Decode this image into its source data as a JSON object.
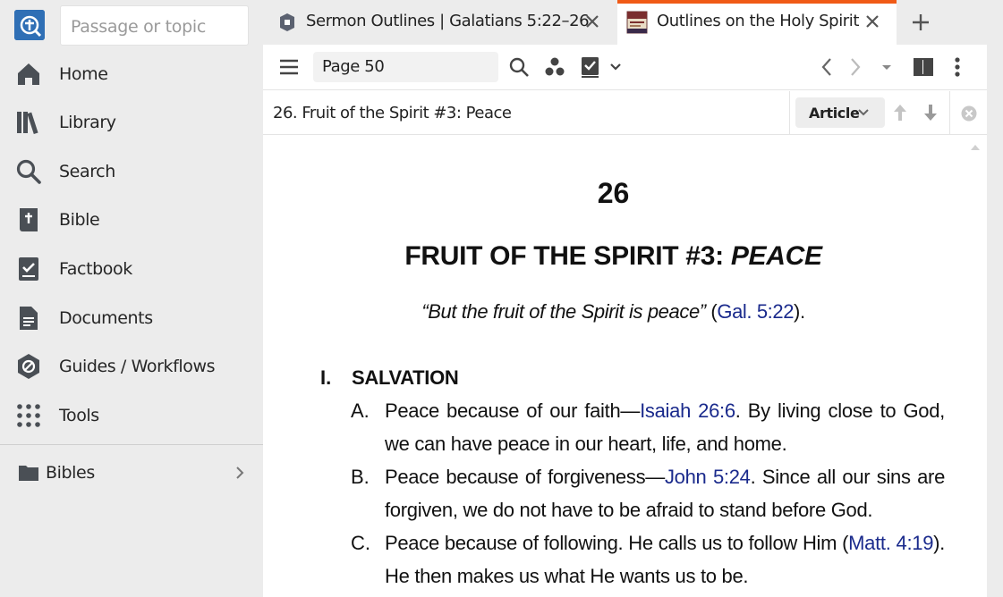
{
  "sidebar": {
    "search_placeholder": "Passage or topic",
    "items": [
      {
        "label": "Home",
        "icon": "home-icon"
      },
      {
        "label": "Library",
        "icon": "library-icon"
      },
      {
        "label": "Search",
        "icon": "search-icon"
      },
      {
        "label": "Bible",
        "icon": "bible-icon"
      },
      {
        "label": "Factbook",
        "icon": "factbook-icon"
      },
      {
        "label": "Documents",
        "icon": "documents-icon"
      },
      {
        "label": "Guides / Workflows",
        "icon": "guides-icon"
      },
      {
        "label": "Tools",
        "icon": "tools-icon"
      }
    ],
    "bibles_label": "Bibles"
  },
  "tabs": [
    {
      "title": "Sermon Outlines | Galatians 5:22–26",
      "active": false
    },
    {
      "title": "Outlines on the Holy Spirit",
      "active": true
    }
  ],
  "toolbar": {
    "page_value": "Page 50"
  },
  "heading_bar": {
    "heading": "26. Fruit of the Spirit #3: Peace",
    "view_select": "Article"
  },
  "document": {
    "number": "26",
    "title_main": "FRUIT OF THE SPIRIT #3: ",
    "title_italic": "PEACE",
    "epigraph_quote": "“But the fruit of the Spirit is peace”",
    "epigraph_open": " (",
    "epigraph_ref": "Gal. 5:22",
    "epigraph_close": ").",
    "section_number": "I.",
    "section_title": "SALVATION",
    "points": [
      {
        "letter": "A.",
        "pre": "Peace because of our faith—",
        "ref": "Isaiah 26:6",
        "post": ". By living close to God, we can have peace in our heart, life, and home."
      },
      {
        "letter": "B.",
        "pre": "Peace because of forgiveness—",
        "ref": "John 5:24",
        "post": ". Since all our sins are forgiven, we do not have to be afraid to stand before God."
      },
      {
        "letter": "C.",
        "pre": "Peace because of following. He calls us to follow Him (",
        "ref": "Matt. 4:19",
        "post": "). He then makes us what He wants us to be."
      }
    ]
  },
  "colors": {
    "accent_tab": "#f05a16",
    "link": "#1a2a8c",
    "logo": "#2f6fb5"
  }
}
